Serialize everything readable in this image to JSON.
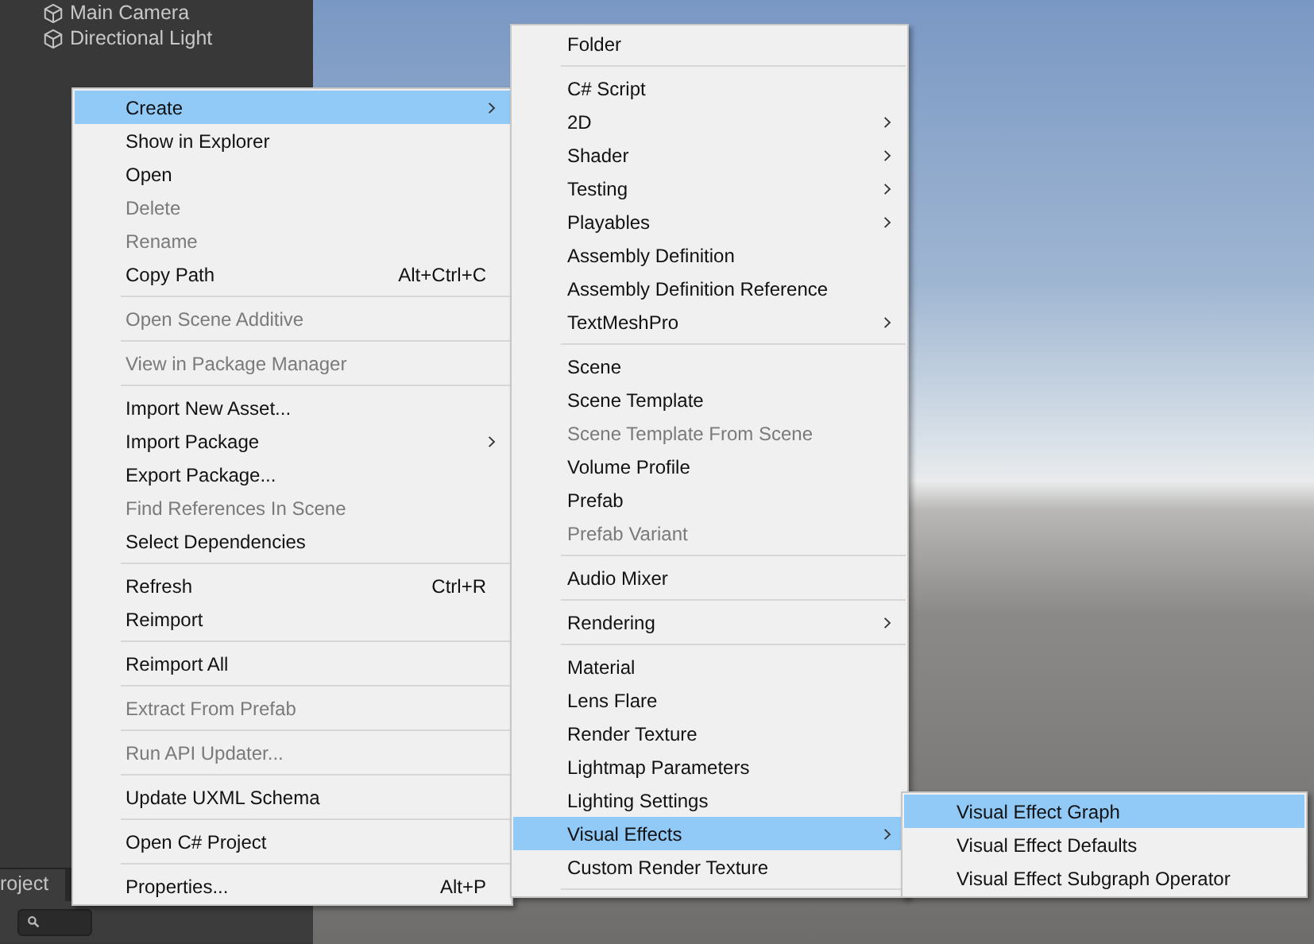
{
  "hierarchy": {
    "items": [
      {
        "label": "Main Camera"
      },
      {
        "label": "Directional Light"
      }
    ]
  },
  "project_panel": {
    "tab": "roject"
  },
  "context_menus": [
    {
      "items": [
        {
          "kind": "item",
          "label": "Create",
          "submenu": true,
          "selected": true,
          "disabled": false
        },
        {
          "kind": "item",
          "label": "Show in Explorer",
          "submenu": false,
          "selected": false,
          "disabled": false
        },
        {
          "kind": "item",
          "label": "Open",
          "submenu": false,
          "selected": false,
          "disabled": false
        },
        {
          "kind": "item",
          "label": "Delete",
          "submenu": false,
          "selected": false,
          "disabled": true
        },
        {
          "kind": "item",
          "label": "Rename",
          "submenu": false,
          "selected": false,
          "disabled": true
        },
        {
          "kind": "item",
          "label": "Copy Path",
          "shortcut": "Alt+Ctrl+C",
          "submenu": false,
          "selected": false,
          "disabled": false
        },
        {
          "kind": "separator"
        },
        {
          "kind": "item",
          "label": "Open Scene Additive",
          "submenu": false,
          "selected": false,
          "disabled": true
        },
        {
          "kind": "separator"
        },
        {
          "kind": "item",
          "label": "View in Package Manager",
          "submenu": false,
          "selected": false,
          "disabled": true
        },
        {
          "kind": "separator"
        },
        {
          "kind": "item",
          "label": "Import New Asset...",
          "submenu": false,
          "selected": false,
          "disabled": false
        },
        {
          "kind": "item",
          "label": "Import Package",
          "submenu": true,
          "selected": false,
          "disabled": false
        },
        {
          "kind": "item",
          "label": "Export Package...",
          "submenu": false,
          "selected": false,
          "disabled": false
        },
        {
          "kind": "item",
          "label": "Find References In Scene",
          "submenu": false,
          "selected": false,
          "disabled": true
        },
        {
          "kind": "item",
          "label": "Select Dependencies",
          "submenu": false,
          "selected": false,
          "disabled": false
        },
        {
          "kind": "separator"
        },
        {
          "kind": "item",
          "label": "Refresh",
          "shortcut": "Ctrl+R",
          "submenu": false,
          "selected": false,
          "disabled": false
        },
        {
          "kind": "item",
          "label": "Reimport",
          "submenu": false,
          "selected": false,
          "disabled": false
        },
        {
          "kind": "separator"
        },
        {
          "kind": "item",
          "label": "Reimport All",
          "submenu": false,
          "selected": false,
          "disabled": false
        },
        {
          "kind": "separator"
        },
        {
          "kind": "item",
          "label": "Extract From Prefab",
          "submenu": false,
          "selected": false,
          "disabled": true
        },
        {
          "kind": "separator"
        },
        {
          "kind": "item",
          "label": "Run API Updater...",
          "submenu": false,
          "selected": false,
          "disabled": true
        },
        {
          "kind": "separator"
        },
        {
          "kind": "item",
          "label": "Update UXML Schema",
          "submenu": false,
          "selected": false,
          "disabled": false
        },
        {
          "kind": "separator"
        },
        {
          "kind": "item",
          "label": "Open C# Project",
          "submenu": false,
          "selected": false,
          "disabled": false
        },
        {
          "kind": "separator"
        },
        {
          "kind": "item",
          "label": "Properties...",
          "shortcut": "Alt+P",
          "submenu": false,
          "selected": false,
          "disabled": false
        }
      ]
    },
    {
      "items": [
        {
          "kind": "item",
          "label": "Folder",
          "submenu": false,
          "selected": false,
          "disabled": false
        },
        {
          "kind": "separator"
        },
        {
          "kind": "item",
          "label": "C# Script",
          "submenu": false,
          "selected": false,
          "disabled": false
        },
        {
          "kind": "item",
          "label": "2D",
          "submenu": true,
          "selected": false,
          "disabled": false
        },
        {
          "kind": "item",
          "label": "Shader",
          "submenu": true,
          "selected": false,
          "disabled": false
        },
        {
          "kind": "item",
          "label": "Testing",
          "submenu": true,
          "selected": false,
          "disabled": false
        },
        {
          "kind": "item",
          "label": "Playables",
          "submenu": true,
          "selected": false,
          "disabled": false
        },
        {
          "kind": "item",
          "label": "Assembly Definition",
          "submenu": false,
          "selected": false,
          "disabled": false
        },
        {
          "kind": "item",
          "label": "Assembly Definition Reference",
          "submenu": false,
          "selected": false,
          "disabled": false
        },
        {
          "kind": "item",
          "label": "TextMeshPro",
          "submenu": true,
          "selected": false,
          "disabled": false
        },
        {
          "kind": "separator"
        },
        {
          "kind": "item",
          "label": "Scene",
          "submenu": false,
          "selected": false,
          "disabled": false
        },
        {
          "kind": "item",
          "label": "Scene Template",
          "submenu": false,
          "selected": false,
          "disabled": false
        },
        {
          "kind": "item",
          "label": "Scene Template From Scene",
          "submenu": false,
          "selected": false,
          "disabled": true
        },
        {
          "kind": "item",
          "label": "Volume Profile",
          "submenu": false,
          "selected": false,
          "disabled": false
        },
        {
          "kind": "item",
          "label": "Prefab",
          "submenu": false,
          "selected": false,
          "disabled": false
        },
        {
          "kind": "item",
          "label": "Prefab Variant",
          "submenu": false,
          "selected": false,
          "disabled": true
        },
        {
          "kind": "separator"
        },
        {
          "kind": "item",
          "label": "Audio Mixer",
          "submenu": false,
          "selected": false,
          "disabled": false
        },
        {
          "kind": "separator"
        },
        {
          "kind": "item",
          "label": "Rendering",
          "submenu": true,
          "selected": false,
          "disabled": false
        },
        {
          "kind": "separator"
        },
        {
          "kind": "item",
          "label": "Material",
          "submenu": false,
          "selected": false,
          "disabled": false
        },
        {
          "kind": "item",
          "label": "Lens Flare",
          "submenu": false,
          "selected": false,
          "disabled": false
        },
        {
          "kind": "item",
          "label": "Render Texture",
          "submenu": false,
          "selected": false,
          "disabled": false
        },
        {
          "kind": "item",
          "label": "Lightmap Parameters",
          "submenu": false,
          "selected": false,
          "disabled": false
        },
        {
          "kind": "item",
          "label": "Lighting Settings",
          "submenu": false,
          "selected": false,
          "disabled": false
        },
        {
          "kind": "item",
          "label": "Visual Effects",
          "submenu": true,
          "selected": true,
          "disabled": false
        },
        {
          "kind": "item",
          "label": "Custom Render Texture",
          "submenu": false,
          "selected": false,
          "disabled": false
        },
        {
          "kind": "separator"
        }
      ]
    },
    {
      "items": [
        {
          "kind": "item",
          "label": "Visual Effect Graph",
          "submenu": false,
          "selected": true,
          "disabled": false
        },
        {
          "kind": "item",
          "label": "Visual Effect Defaults",
          "submenu": false,
          "selected": false,
          "disabled": false
        },
        {
          "kind": "item",
          "label": "Visual Effect Subgraph Operator",
          "submenu": false,
          "selected": false,
          "disabled": false
        }
      ]
    }
  ]
}
